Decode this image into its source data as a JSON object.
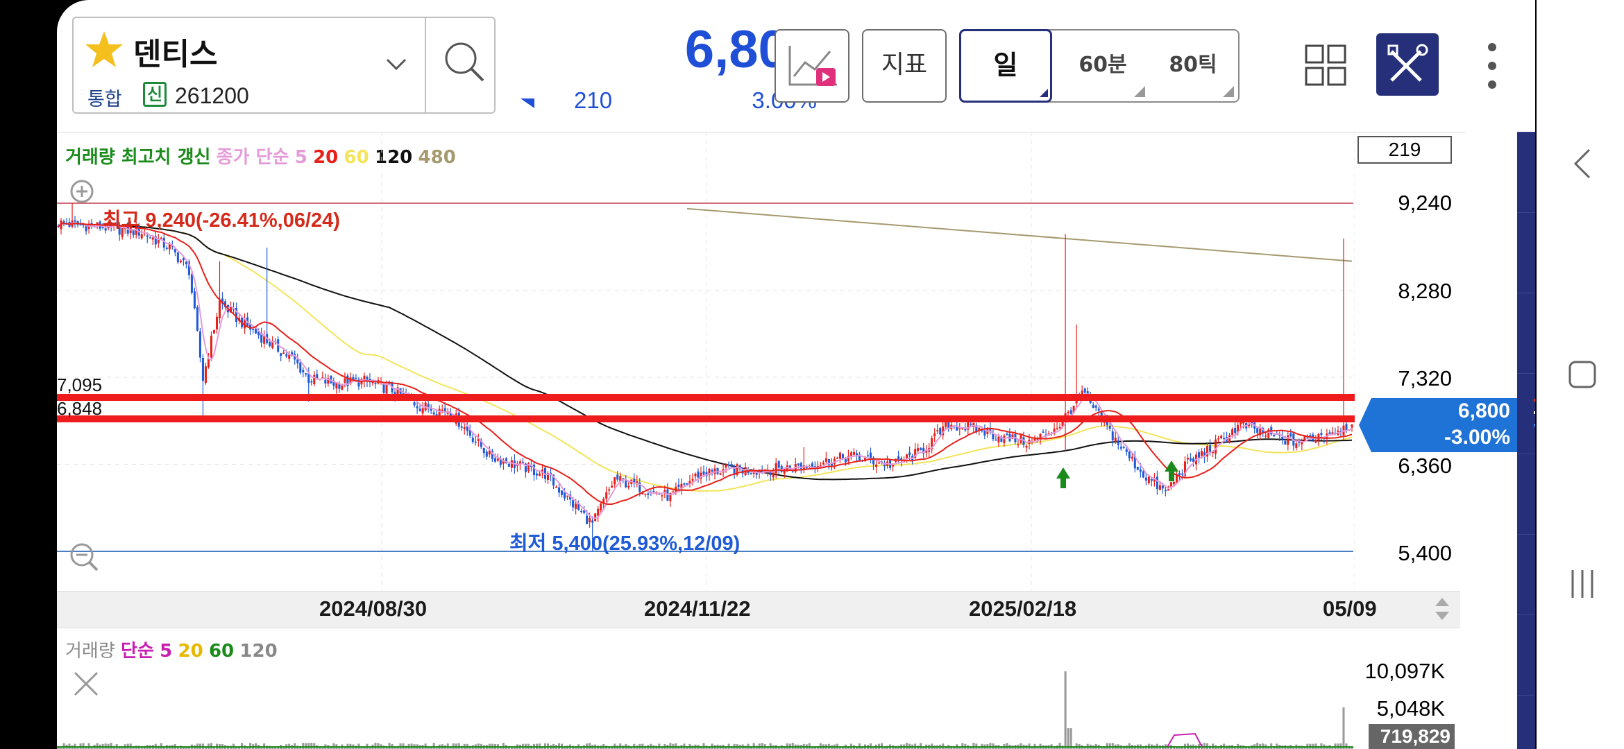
{
  "stock": {
    "name": "덴티스",
    "market_label": "통합",
    "credit_badge": "신",
    "code": "261200",
    "price": "6,800",
    "change": "210",
    "change_rate": "3.00%"
  },
  "toolbar_top": {
    "indicator_label": "지표",
    "timeframes": [
      "일",
      "60분",
      "80틱"
    ],
    "selected_timeframe": "일"
  },
  "chart_header": {
    "volume_high": "거래량 최고치 갱신",
    "ma_label": "종가 단순",
    "ma_periods": [
      "5",
      "20",
      "60",
      "120",
      "480"
    ],
    "candle_count": "219"
  },
  "price_axis": {
    "ticks": [
      "9,240",
      "8,280",
      "7,320",
      "6,360",
      "5,400"
    ],
    "current_price": "6,800",
    "current_change": "-3.00%"
  },
  "date_axis": {
    "ticks": [
      "2024/08/30",
      "2024/11/22",
      "2025/02/18",
      "05/09"
    ]
  },
  "annotations": {
    "high": "최고 9,240(-26.41%,06/24)",
    "low": "최저 5,400(25.93%,12/09)",
    "line1": "7,095",
    "line2": "6,848"
  },
  "volume_panel": {
    "title": "거래량",
    "ma_label": "단순",
    "ma_periods": [
      "5",
      "20",
      "60",
      "120"
    ],
    "ticks": [
      "10,097K",
      "5,048K"
    ],
    "current": "719,829"
  },
  "colors": {
    "up": "#e8201a",
    "down": "#1f5bd6",
    "ma5": "#e59ad9",
    "ma20": "#e8201a",
    "ma60": "#f3e45a",
    "ma120": "#111111",
    "ma480": "#a59a6e",
    "toolbar": "#26307a",
    "price_blue": "#1f4fd6"
  },
  "chart_data": {
    "type": "candlestick",
    "title": "",
    "ylim": [
      5400,
      9240
    ],
    "y_ticks": [
      9240,
      8280,
      7320,
      6360,
      5400
    ],
    "x_ticks": [
      "2024/08/30",
      "2024/11/22",
      "2025/02/18",
      "05/09"
    ],
    "horizontal_lines": [
      7095,
      6848
    ],
    "high": {
      "value": 9240,
      "date": "06/24"
    },
    "low": {
      "value": 5400,
      "date": "12/09"
    },
    "last_close": 6800,
    "ma480_range": [
      9180,
      8600
    ],
    "series": [
      {
        "name": "5",
        "values": []
      },
      {
        "name": "20",
        "values": []
      },
      {
        "name": "60",
        "values": []
      },
      {
        "name": "120",
        "values": []
      },
      {
        "name": "480",
        "values": []
      }
    ],
    "volume_max": "10,097K",
    "volume_last": "719,829"
  }
}
